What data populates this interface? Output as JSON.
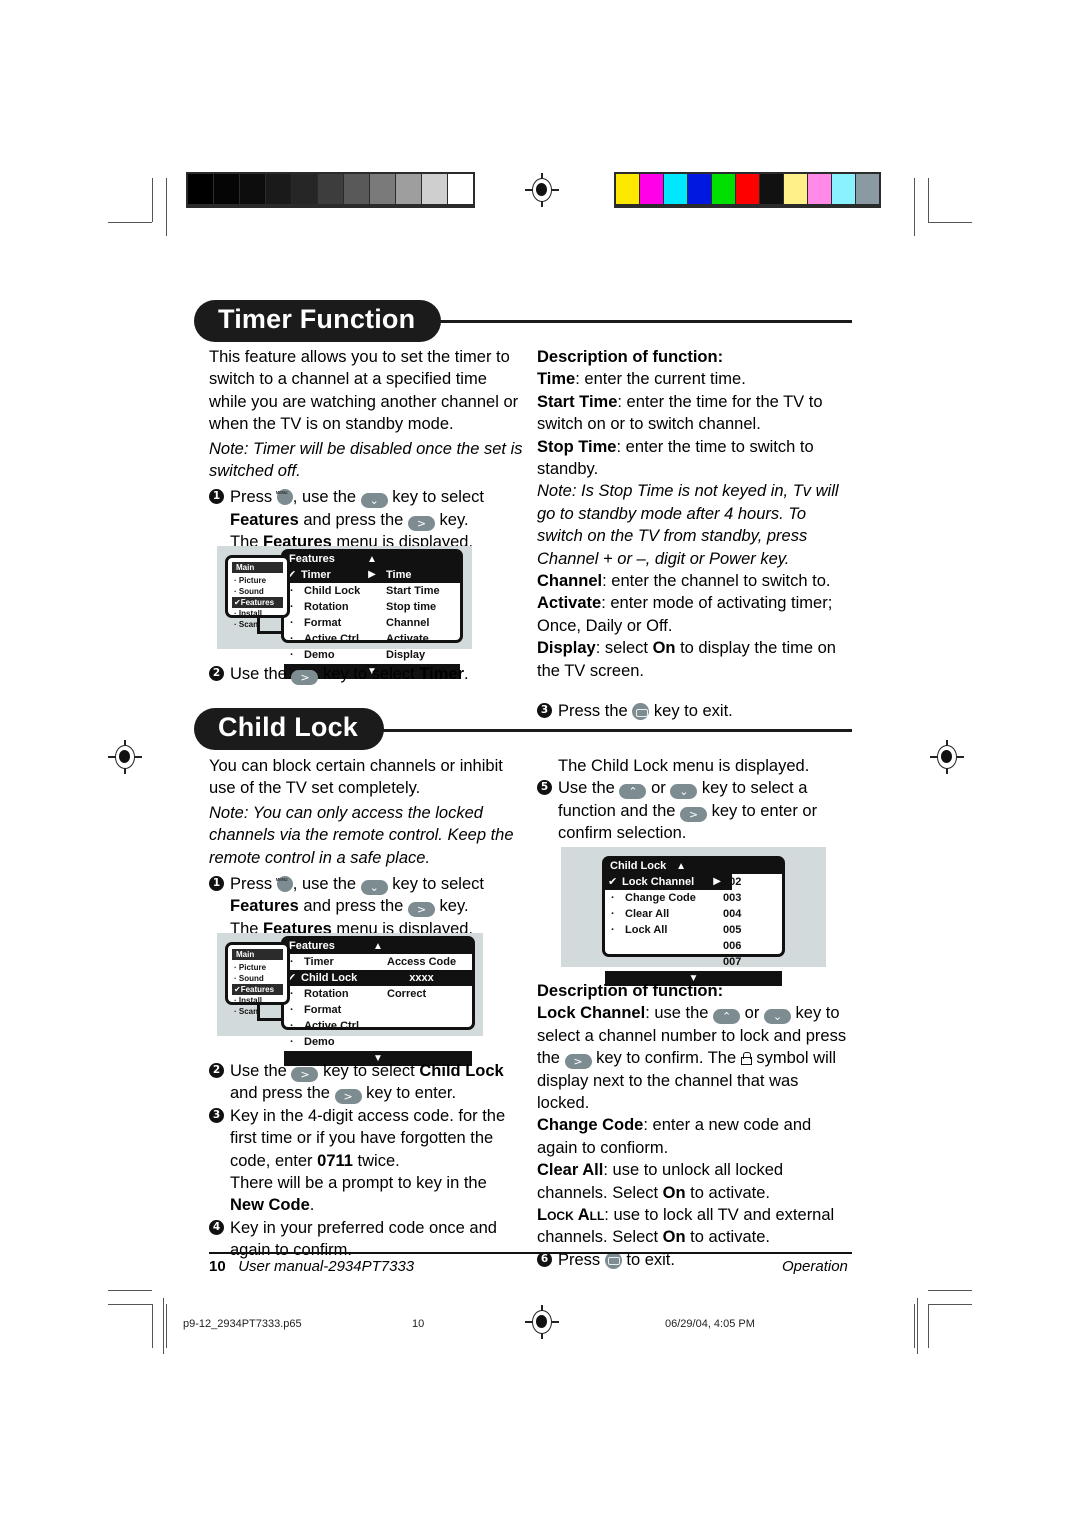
{
  "colorbars": {
    "grayscale": [
      "#000000",
      "#050505",
      "#0d0d0d",
      "#1a1a1a",
      "#262626",
      "#3d3d3d",
      "#595959",
      "#7a7a7a",
      "#9e9e9e",
      "#cfcfcf",
      "#ffffff"
    ],
    "colors": [
      "#ffe800",
      "#ff00e8",
      "#00e8ff",
      "#0018e0",
      "#00e000",
      "#ff0000",
      "#111111",
      "#fff08a",
      "#ff8ae8",
      "#8af2ff",
      "#8a9aa3"
    ]
  },
  "timer": {
    "heading": "Timer Function",
    "intro": "This feature allows you to set the timer to switch to a channel at a specified time while you are watching another channel or when the TV is on standby mode.",
    "note": "Note: Timer will be disabled once the set is switched off.",
    "step1": {
      "num": "1",
      "part1": "Press",
      "part2": ", use the",
      "part3": "key to select",
      "bold1": "Features",
      "part4": "and press the",
      "part5": "key.",
      "part6": "The",
      "bold2": "Features",
      "part7": "menu is displayed."
    },
    "step2": {
      "num": "2",
      "part1": "Use the",
      "part2": "key to select",
      "bold1": "Timer",
      "part3": "."
    },
    "step3": {
      "num": "3",
      "part1": "Press the",
      "part2": "key to exit."
    },
    "osd": {
      "main_title": "Main",
      "main_items": [
        "Picture",
        "Sound",
        "Features",
        "Install",
        "Scan"
      ],
      "main_selected": "Features",
      "panel_title": "Features",
      "rows": [
        "Timer",
        "Child Lock",
        "Rotation",
        "Format",
        "Active Ctrl",
        "Demo"
      ],
      "selected_row": "Timer",
      "values": [
        "Time",
        "Start Time",
        "Stop time",
        "Channel",
        "Activate",
        "Display"
      ],
      "up_arrow": "▲",
      "down_arrow": "▼",
      "right_arrow": "▶",
      "tick": "✔"
    },
    "description": {
      "title": "Description of function:",
      "items": [
        {
          "term": "Time",
          "text": ": enter the current time."
        },
        {
          "term": "Start Time",
          "text": ": enter the time for the TV to switch on or to switch channel."
        },
        {
          "term": "Stop Time",
          "text": ": enter the time to switch to standby."
        }
      ],
      "note": "Note: Is Stop Time is not keyed in, Tv will go to standby mode after 4 hours. To switch on the TV from standby, press Channel + or –, digit or Power key.",
      "items2": [
        {
          "term": "Channel",
          "text": ": enter the channel to switch to."
        },
        {
          "term": "Activate",
          "text": ": enter mode of activating timer; Once, Daily or Off."
        }
      ],
      "display_term": "Display",
      "display_pre": ": select ",
      "display_on": "On",
      "display_post": " to display the time on the TV screen."
    }
  },
  "childlock": {
    "heading": "Child Lock",
    "intro": "You can block certain channels or inhibit use of the TV set completely.",
    "note": "Note: You can only access the locked channels via the remote control. Keep the remote control in a safe place.",
    "step1": {
      "num": "1",
      "part1": "Press",
      "part2": ", use the",
      "part3": "key to select",
      "bold1": "Features",
      "part4": "and press the",
      "part5": "key.",
      "part6": "The",
      "bold2": "Features",
      "part7": "menu is displayed."
    },
    "step2": {
      "num": "2",
      "part1": "Use the",
      "part2": "key to select",
      "bold1": "Child Lock",
      "part3": "and press the",
      "part4": "key to enter."
    },
    "step3": {
      "num": "3",
      "part1": "Key in the 4-digit access code. for the first time or if you have forgotten the code, enter ",
      "bold1": "0711",
      "part2": " twice.",
      "part3": "There will be a prompt to key in the",
      "bold2": "New Code",
      "part4": "."
    },
    "step4": {
      "num": "4",
      "part1": "Key in your preferred code once and again to confirm."
    },
    "step5": {
      "num": "5",
      "lead": "The Child Lock menu is displayed.",
      "part1": "Use the",
      "part2": "or",
      "part3": "key to select a function and the",
      "part4": "key to enter or confirm selection."
    },
    "step6": {
      "num": "6",
      "part1": "Press",
      "part2": "to exit."
    },
    "osd_features": {
      "main_title": "Main",
      "main_items": [
        "Picture",
        "Sound",
        "Features",
        "Install",
        "Scan"
      ],
      "main_selected": "Features",
      "panel_title": "Features",
      "rows": [
        "Timer",
        "Child Lock",
        "Rotation",
        "Format",
        "Active Ctrl",
        "Demo"
      ],
      "selected_row": "Child Lock",
      "values": [
        "Access Code",
        "xxxx",
        "Correct"
      ],
      "up_arrow": "▲",
      "down_arrow": "▼",
      "right_arrow": "▶",
      "tick": "✔"
    },
    "osd_childlock": {
      "panel_title": "Child Lock",
      "rows": [
        "Lock Channel",
        "Change Code",
        "Clear All",
        "Lock All"
      ],
      "selected_row": "Lock Channel",
      "values": [
        "002",
        "003",
        "004",
        "005",
        "006",
        "007"
      ],
      "up_arrow": "▲",
      "down_arrow": "▼",
      "right_arrow": "▶",
      "tick": "✔"
    },
    "description": {
      "title": "Description of function:",
      "lock_channel_term": "Lock Channel",
      "lock_channel_p1": ": use the",
      "lock_channel_p2": "or",
      "lock_channel_p3": "key to select a channel number to lock and press the",
      "lock_channel_p4": "key to confirm. The",
      "lock_channel_p5": "symbol will display next to the channel that was locked.",
      "change_code_term": "Change Code",
      "change_code_text": ": enter a new code and again to confiorm.",
      "clear_all_term": "Clear All",
      "clear_all_pre": ": use to unlock all locked channels. Select ",
      "clear_all_on": "On",
      "clear_all_post": " to activate.",
      "lock_all_term": "Lock All",
      "lock_all_pre": ": use to lock all TV and external channels. Select ",
      "lock_all_on": "On",
      "lock_all_post": " to activate."
    }
  },
  "keys": {
    "down": "⌄",
    "up": "⌃",
    "right": ">",
    "menu": "menu-key",
    "exit": "exit-key"
  },
  "footer": {
    "page": "10",
    "manual": "User manual-2934PT7333",
    "section": "Operation"
  },
  "printline": {
    "file": "p9-12_2934PT7333.p65",
    "page": "10",
    "date": "06/29/04, 4:05 PM"
  }
}
